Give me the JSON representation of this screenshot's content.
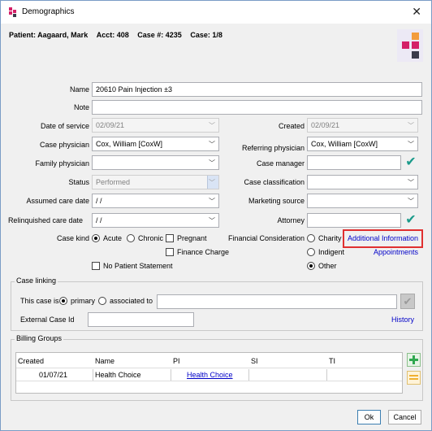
{
  "window": {
    "title": "Demographics",
    "close_glyph": "✕"
  },
  "header": {
    "patient_text": "Patient: Aagaard, Mark",
    "acct_text": "Acct: 408",
    "case_no_text": "Case #: 4235",
    "case_of_text": "Case: 1/8"
  },
  "brand_colors": {
    "pink": "#d42067",
    "orange": "#f39c3c",
    "dark": "#3a3a4a"
  },
  "fields": {
    "name": {
      "label": "Name",
      "value": "20610 Pain Injection ±3"
    },
    "note": {
      "label": "Note",
      "value": ""
    },
    "date_of_service": {
      "label": "Date of service",
      "value": "02/09/21"
    },
    "created": {
      "label": "Created",
      "value": "02/09/21"
    },
    "case_physician": {
      "label": "Case physician",
      "value": "Cox, William  [CoxW]"
    },
    "referring_physician": {
      "label": "Referring physician",
      "value": "Cox, William  [CoxW]"
    },
    "family_physician": {
      "label": "Family physician",
      "value": ""
    },
    "case_manager": {
      "label": "Case manager",
      "value": ""
    },
    "status": {
      "label": "Status",
      "value": "Performed"
    },
    "case_classification": {
      "label": "Case classification",
      "value": ""
    },
    "assumed_care_date": {
      "label": "Assumed care date",
      "value": "/ /"
    },
    "marketing_source": {
      "label": "Marketing source",
      "value": ""
    },
    "relinquished_care_date": {
      "label": "Relinquished care date",
      "value": "/ /"
    },
    "attorney": {
      "label": "Attorney",
      "value": ""
    }
  },
  "case_kind": {
    "label": "Case kind",
    "acute": "Acute",
    "chronic": "Chronic",
    "pregnant": "Pregnant",
    "finance_charge": "Finance Charge",
    "selected": "Acute"
  },
  "financial": {
    "label": "Financial Consideration",
    "charity": "Charity",
    "indigent": "Indigent",
    "other": "Other",
    "selected": "Other",
    "additional_info_link": "Additional Information",
    "appointments_link": "Appointments"
  },
  "no_patient_statement": "No Patient Statement",
  "case_linking": {
    "label": "Case linking",
    "this_case_is": "This case is",
    "primary": "primary",
    "associated_to": "associated to",
    "external_case_id": "External Case Id",
    "history_link": "History"
  },
  "billing_groups": {
    "label": "Billing Groups",
    "columns": [
      "Created",
      "Name",
      "PI",
      "SI",
      "TI"
    ],
    "rows": [
      {
        "created": "01/07/21",
        "name": "Health Choice",
        "pi": "Health Choice",
        "si": "",
        "ti": ""
      }
    ]
  },
  "buttons": {
    "ok": "Ok",
    "cancel": "Cancel"
  },
  "highlight_color": "#e03030"
}
